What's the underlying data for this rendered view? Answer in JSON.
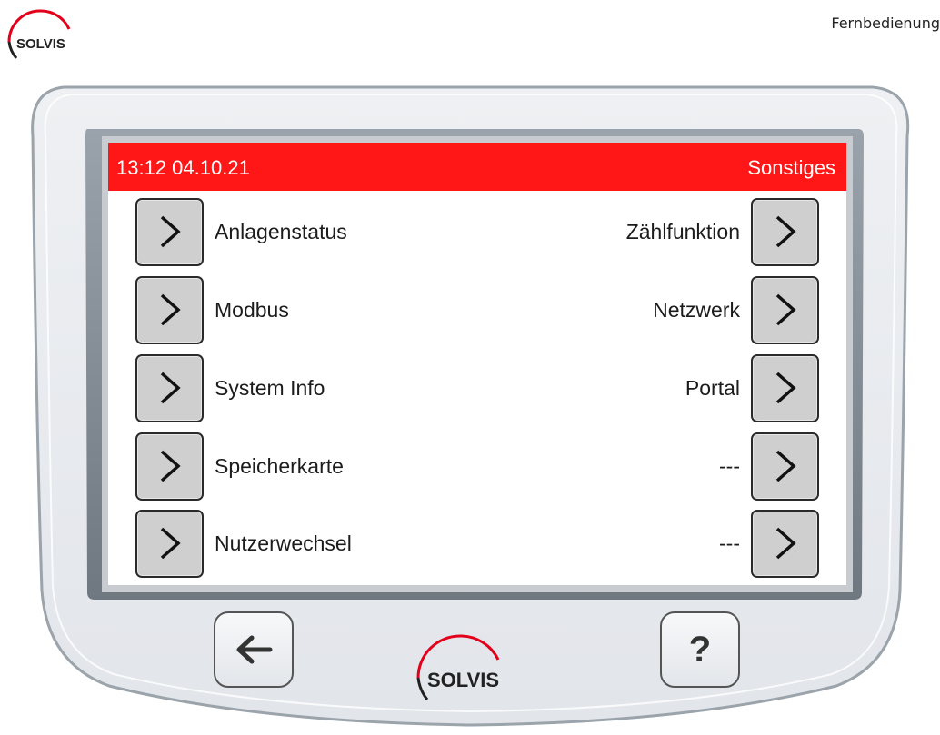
{
  "header": {
    "brand": "SOLVIS",
    "caption": "Fernbedienung"
  },
  "screen": {
    "status_time": "13:12 04.10.21",
    "status_title": "Sonstiges",
    "left_items": [
      {
        "label": "Anlagenstatus"
      },
      {
        "label": "Modbus"
      },
      {
        "label": "System Info"
      },
      {
        "label": "Speicherkarte"
      },
      {
        "label": "Nutzerwechsel"
      }
    ],
    "right_items": [
      {
        "label": "Zählfunktion"
      },
      {
        "label": "Netzwerk"
      },
      {
        "label": "Portal"
      },
      {
        "label": "---"
      },
      {
        "label": "---"
      }
    ]
  },
  "device": {
    "back_icon": "arrow-left-icon",
    "help_label": "?",
    "brand": "SOLVIS"
  },
  "colors": {
    "status_bar": "#ff1616",
    "button_gray": "#cfcfcf",
    "brand_red": "#e3001b"
  }
}
